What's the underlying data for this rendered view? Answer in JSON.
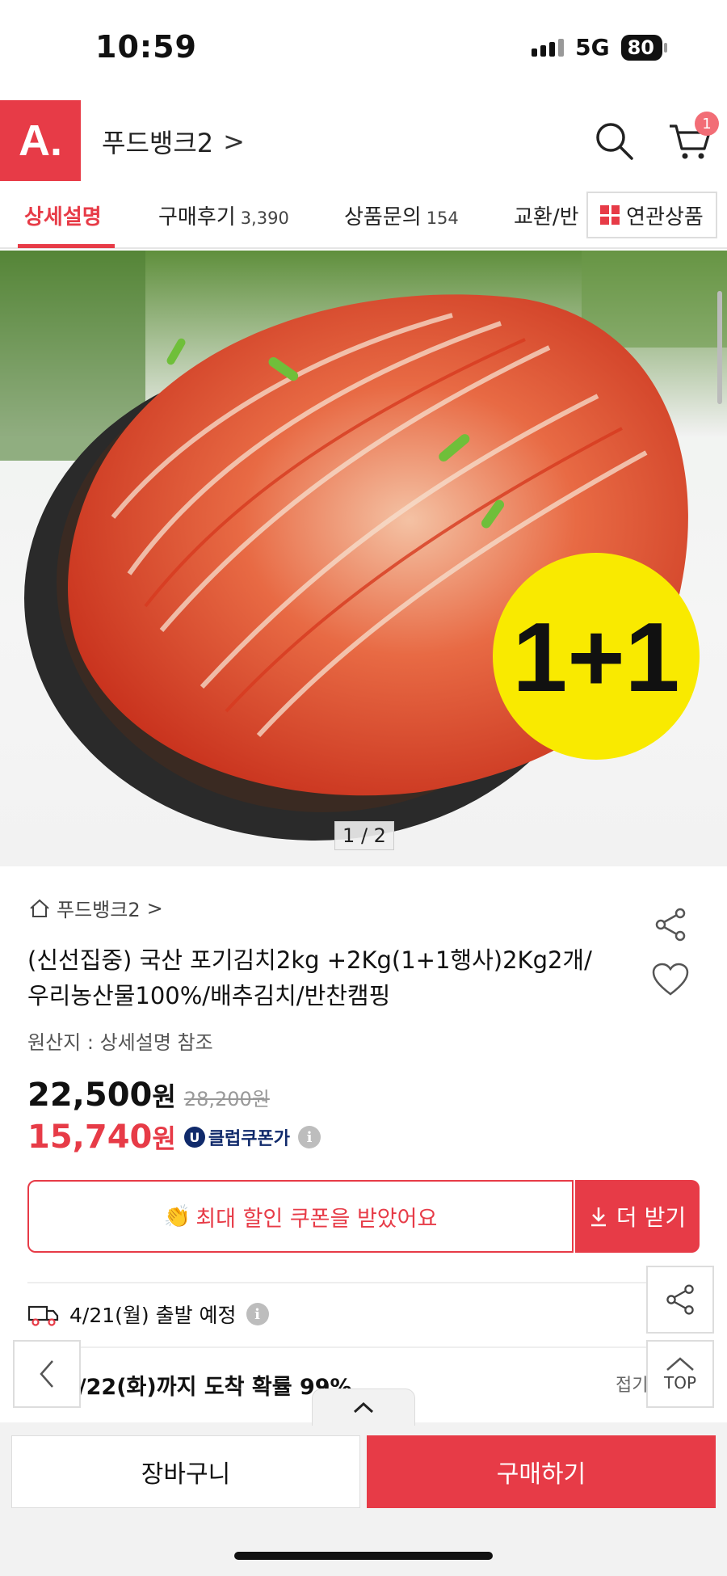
{
  "status_bar": {
    "time": "10:59",
    "network": "5G",
    "battery": "80"
  },
  "header": {
    "logo": "A.",
    "store_name": "푸드뱅크2",
    "store_chevron": ">",
    "cart_count": "1"
  },
  "tabs": [
    {
      "label": "상세설명",
      "count": ""
    },
    {
      "label": "구매후기",
      "count": "3,390"
    },
    {
      "label": "상품문의",
      "count": "154"
    },
    {
      "label": "교환/반",
      "count": ""
    }
  ],
  "related_label": "연관상품",
  "hero": {
    "badge": "1+1",
    "indicator": "1 / 2"
  },
  "product": {
    "store_link": "푸드뱅크2",
    "title": "(신선집중) 국산 포기김치2kg +2Kg(1+1행사)2Kg2개/우리농산물100%/배추김치/반찬캠핑",
    "origin": "원산지 : 상세설명 참조",
    "price": "22,500",
    "price_unit": "원",
    "old_price": "28,200원",
    "sale_price": "15,740",
    "sale_unit": "원",
    "club_badge": "U",
    "club_label": "클럽쿠폰가",
    "info": "i"
  },
  "coupon": {
    "message": "최대 할인 쿠폰을 받았어요",
    "emoji": "👏",
    "button": "더 받기"
  },
  "shipping": {
    "departure": "4/21(월) 출발 예정",
    "arrival": "4/22(화)까지 도착 확률 99%",
    "fold": "접기"
  },
  "float": {
    "top_label": "TOP"
  },
  "bottom": {
    "cart_button": "장바구니",
    "buy_button": "구매하기"
  },
  "colors": {
    "brand": "#e73b47",
    "club": "#102a6b"
  }
}
